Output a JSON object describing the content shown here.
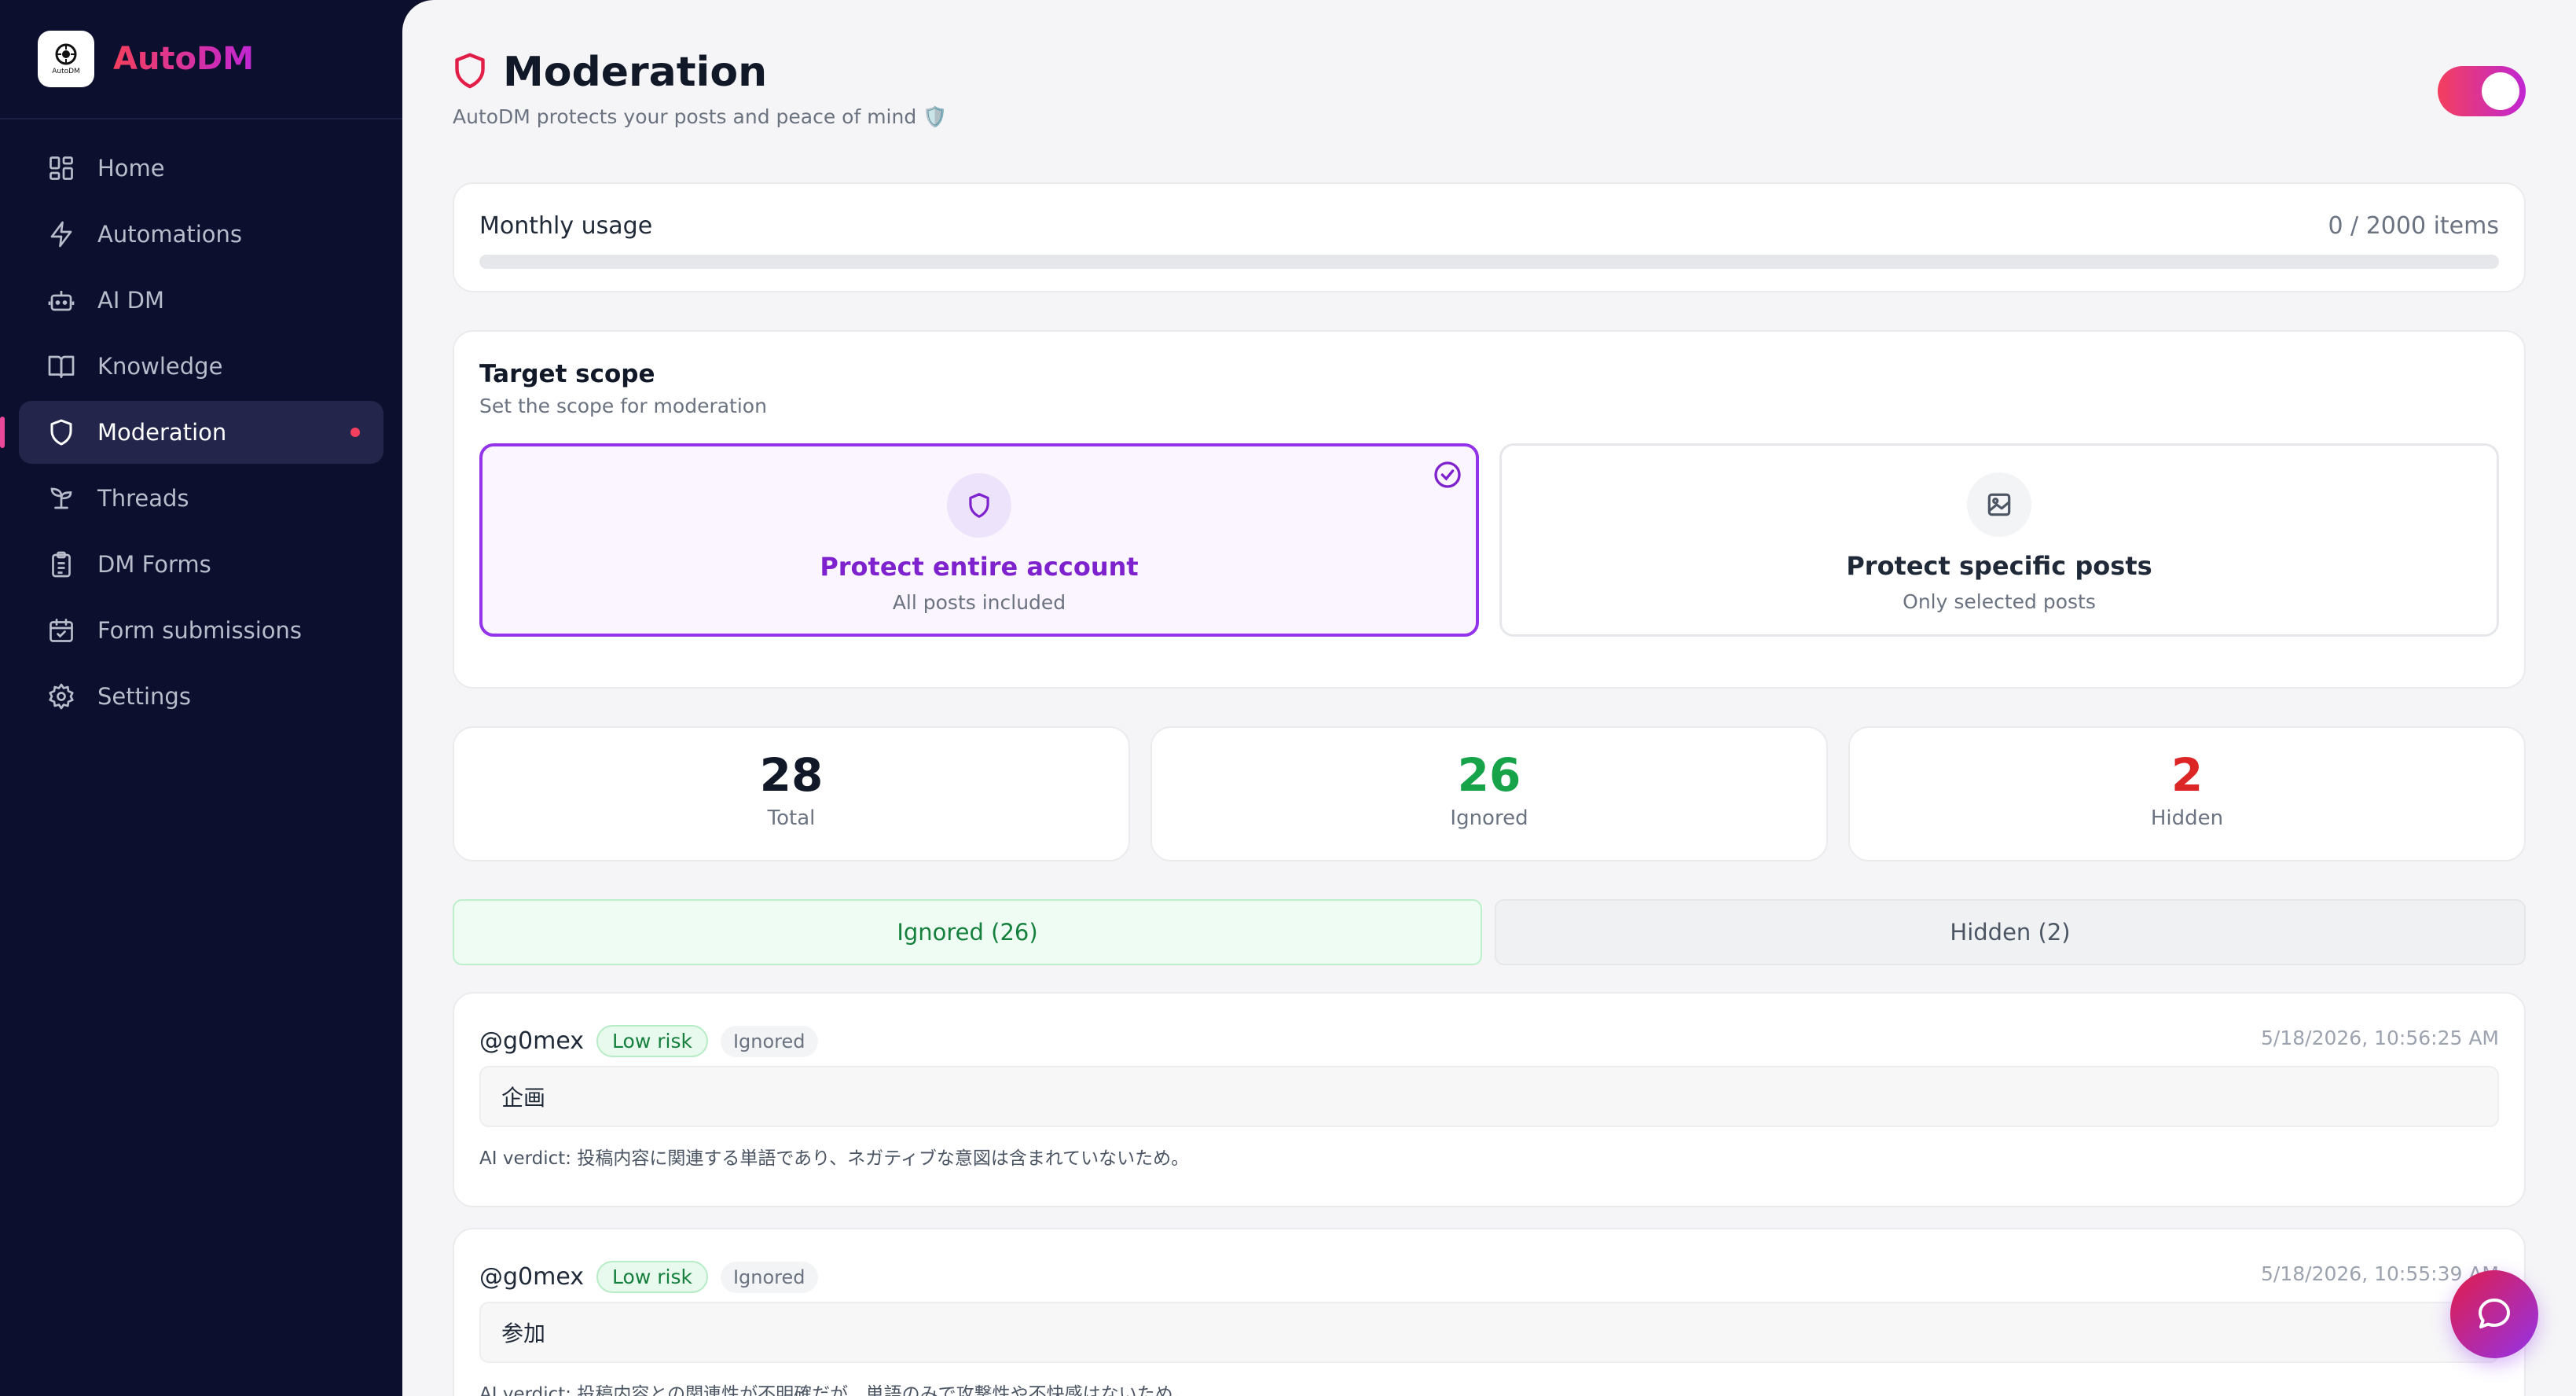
{
  "app": {
    "name": "AutoDM",
    "logo_text": "AutoDM"
  },
  "colors": {
    "accent": "#c026d3",
    "brand_start": "#f43f5e",
    "ignored_green": "#16a34a",
    "hidden_red": "#dc2626"
  },
  "sidebar": {
    "items": [
      {
        "label": "Home",
        "icon": "grid-icon"
      },
      {
        "label": "Automations",
        "icon": "lightning-icon"
      },
      {
        "label": "AI DM",
        "icon": "robot-icon"
      },
      {
        "label": "Knowledge",
        "icon": "book-icon"
      },
      {
        "label": "Moderation",
        "icon": "shield-icon",
        "active": true
      },
      {
        "label": "Threads",
        "icon": "sprout-icon"
      },
      {
        "label": "DM Forms",
        "icon": "clipboard-icon"
      },
      {
        "label": "Form submissions",
        "icon": "calendar-check-icon"
      },
      {
        "label": "Settings",
        "icon": "gear-icon"
      }
    ]
  },
  "header": {
    "title": "Moderation",
    "subtitle": "AutoDM protects your posts and peace of mind 🛡️",
    "enabled": true
  },
  "usage": {
    "label": "Monthly usage",
    "value_text": "0 / 2000 items",
    "fraction": 0
  },
  "scope": {
    "title": "Target scope",
    "subtitle": "Set the scope for moderation",
    "options": [
      {
        "title": "Protect entire account",
        "subtitle": "All posts included",
        "selected": true,
        "icon": "shield-icon"
      },
      {
        "title": "Protect specific posts",
        "subtitle": "Only selected posts",
        "selected": false,
        "icon": "image-icon"
      }
    ]
  },
  "stats": {
    "total": {
      "value": "28",
      "label": "Total"
    },
    "ignored": {
      "value": "26",
      "label": "Ignored"
    },
    "hidden": {
      "value": "2",
      "label": "Hidden"
    }
  },
  "tabs": {
    "ignored": "Ignored (26)",
    "hidden": "Hidden (2)"
  },
  "items": [
    {
      "user": "@g0mex",
      "risk": "Low risk",
      "status": "Ignored",
      "time": "5/18/2026, 10:56:25 AM",
      "comment": "企画",
      "verdict": "AI verdict: 投稿内容に関連する単語であり、ネガティブな意図は含まれていないため。"
    },
    {
      "user": "@g0mex",
      "risk": "Low risk",
      "status": "Ignored",
      "time": "5/18/2026, 10:55:39 AM",
      "comment": "参加",
      "verdict": "AI verdict: 投稿内容との関連性が不明確だが、単語のみで攻撃性や不快感はないため。"
    }
  ]
}
